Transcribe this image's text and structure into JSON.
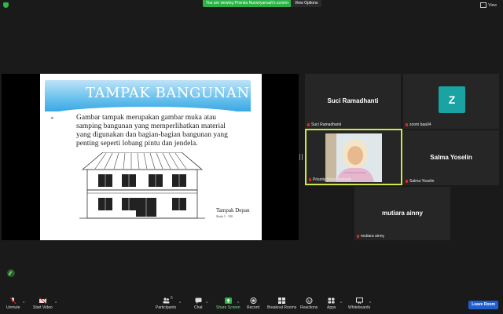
{
  "topbar": {
    "banner": "You are viewing Prisnita Nurwriyansah's screen",
    "view_options": "View Options",
    "view_button": "View"
  },
  "slide": {
    "title": "TAMPAK BANGUNAN",
    "bullet": "➢",
    "lines": [
      "Gambar tampak merupakan gambar muka atau",
      "samping bangunan yang memperlihatkan material",
      "yang digunakan dan bagian-bagian bangunan yang",
      "penting seperti lobang pintu dan jendela."
    ],
    "caption": "Tampak Depan",
    "scale": "Skala 1 : 100"
  },
  "participants": [
    {
      "display": "Suci Ramadhanti",
      "label": "Suci Ramadhanti"
    },
    {
      "display": "Z",
      "label": "zoom baa04"
    },
    {
      "display": "",
      "label": "Prisnita Nurwriyansah"
    },
    {
      "display": "Salma Yoselin",
      "label": "Salma Yoselin"
    },
    {
      "display": "mutiara ainny",
      "label": "mutiara ainny"
    }
  ],
  "toolbar": {
    "unmute": "Unmute",
    "start_video": "Start Video",
    "participants": "Participants",
    "participants_count": "5",
    "chat": "Chat",
    "share_screen": "Share Screen",
    "record": "Record",
    "breakout_rooms": "Breakout Rooms",
    "reactions": "Reactions",
    "apps": "Apps",
    "whiteboards": "Whiteboards",
    "leave": "Leave Room"
  },
  "colors": {
    "accent_green": "#2eb248",
    "leave_blue": "#1e5fd1",
    "active_speaker": "#d0e64a",
    "avatar_teal": "#1aa3a3"
  }
}
